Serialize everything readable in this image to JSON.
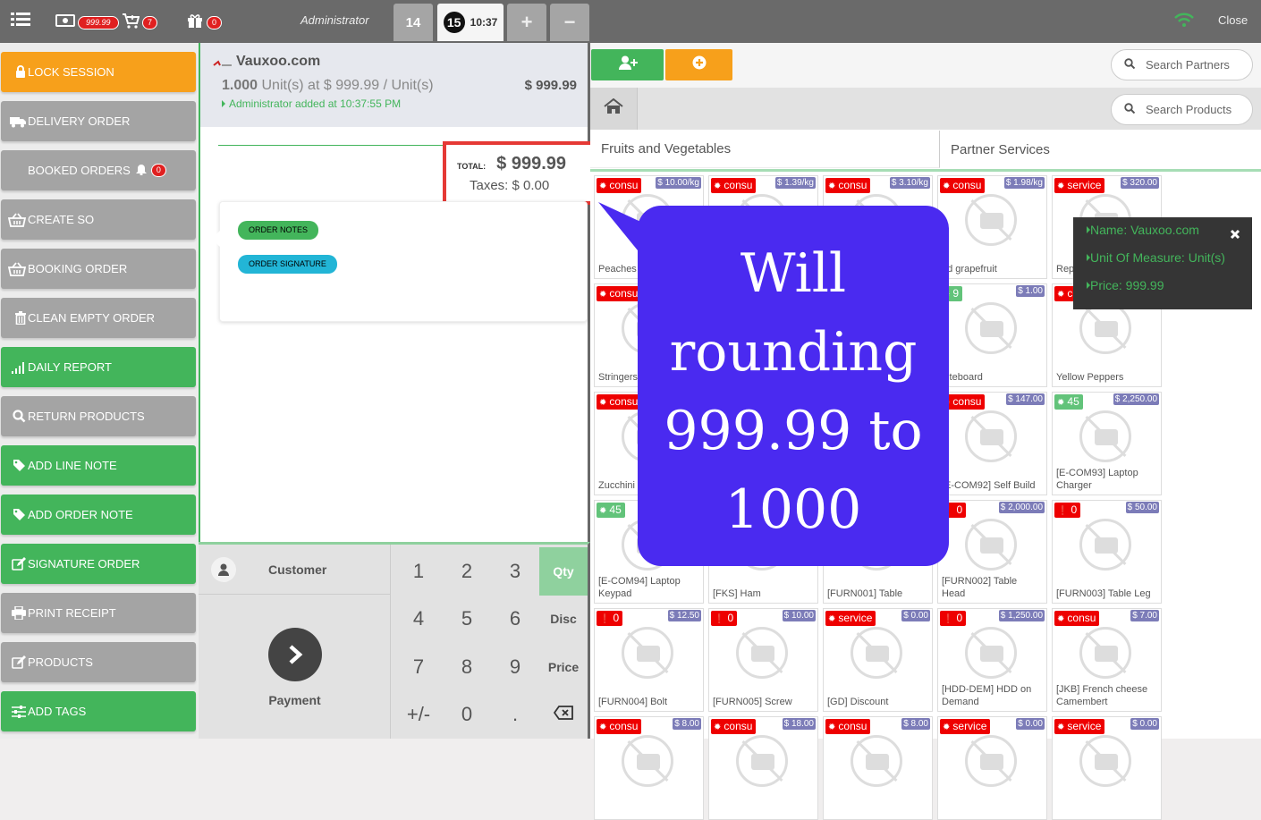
{
  "topbar": {
    "cash_badge": "999.99",
    "cart_badge": "7",
    "gift_badge": "0",
    "user": "Administrator",
    "order_tabs": [
      {
        "number": "14"
      },
      {
        "number": "15",
        "time": "10:37"
      }
    ],
    "add_label": "+",
    "remove_label": "−",
    "close_label": "Close"
  },
  "sidebar": [
    {
      "label": "LOCK SESSION",
      "icon": "lock-icon",
      "color": "orange"
    },
    {
      "label": "DELIVERY ORDER",
      "icon": "truck-icon",
      "color": "gray"
    },
    {
      "label": "BOOKED ORDERS",
      "icon": "bell-icon",
      "color": "gray",
      "badge": "0"
    },
    {
      "label": "CREATE SO",
      "icon": "basket-icon",
      "color": "gray"
    },
    {
      "label": "BOOKING ORDER",
      "icon": "basket-icon",
      "color": "gray"
    },
    {
      "label": "CLEAN EMPTY ORDER",
      "icon": "trash-icon",
      "color": "gray"
    },
    {
      "label": "DAILY REPORT",
      "icon": "signal-icon",
      "color": "green"
    },
    {
      "label": "RETURN PRODUCTS",
      "icon": "search-icon",
      "color": "gray"
    },
    {
      "label": "ADD LINE NOTE",
      "icon": "tag-icon",
      "color": "green"
    },
    {
      "label": "ADD ORDER NOTE",
      "icon": "tag-icon",
      "color": "green"
    },
    {
      "label": "SIGNATURE ORDER",
      "icon": "edit-icon",
      "color": "green"
    },
    {
      "label": "PRINT RECEIPT",
      "icon": "print-icon",
      "color": "gray"
    },
    {
      "label": "PRODUCTS",
      "icon": "edit-icon",
      "color": "gray"
    },
    {
      "label": "ADD TAGS",
      "icon": "sliders-icon",
      "color": "green"
    }
  ],
  "orderline": {
    "name": "Vauxoo.com",
    "qty": "1.000",
    "unit_text": "Unit(s) at $ 999.99 / Unit(s)",
    "price": "$ 999.99",
    "added": "Administrator added at 10:37:55 PM"
  },
  "summary": {
    "total_label": "TOTAL:",
    "total": "$ 999.99",
    "taxes": "Taxes: $ 0.00"
  },
  "notes": {
    "order_notes": "ORDER NOTES",
    "order_signature": "ORDER SIGNATURE"
  },
  "annotation": {
    "text": "Will rounding 999.99 to 1000",
    "color": "#4a2af0"
  },
  "pad": {
    "customer": "Customer",
    "payment": "Payment",
    "keys": [
      "1",
      "2",
      "3",
      "Qty",
      "4",
      "5",
      "6",
      "Disc",
      "7",
      "8",
      "9",
      "Price",
      "+/-",
      "0",
      "."
    ]
  },
  "search": {
    "partners_placeholder": "Search Partners",
    "products_placeholder": "Search Products"
  },
  "categories": [
    "Fruits and Vegetables",
    "Partner Services"
  ],
  "tooltip": {
    "name": "Name: Vauxoo.com",
    "uom": "Unit Of Measure: Unit(s)",
    "price": "Price: 999.99"
  },
  "products": [
    {
      "name": "Peaches",
      "tag": "consu",
      "price": "$ 10.00/kg"
    },
    {
      "name": "",
      "tag": "consu",
      "price": "$ 1.39/kg"
    },
    {
      "name": "",
      "tag": "consu",
      "price": "$ 3.10/kg"
    },
    {
      "name": "ed grapefruit",
      "tag": "consu",
      "price": "$ 1.98/kg"
    },
    {
      "name": "Repair",
      "tag": "service",
      "price": "$ 320.00"
    },
    {
      "name": "Stringers",
      "tag": "consu",
      "price": ""
    },
    {
      "name": "",
      "tag": "",
      "price": ""
    },
    {
      "name": "",
      "tag": "",
      "price": ""
    },
    {
      "name": "hiteboard",
      "tag": "9",
      "price": "$ 1.00"
    },
    {
      "name": "Yellow Peppers",
      "tag": "consu",
      "price": ""
    },
    {
      "name": "Zucchini",
      "tag": "consu",
      "price": ""
    },
    {
      "name": "",
      "tag": "",
      "price": ""
    },
    {
      "name": "",
      "tag": "",
      "price": ""
    },
    {
      "name": "[E-COM92] Self Build",
      "tag": "consu",
      "price": "$ 147.00"
    },
    {
      "name": "[E-COM93] Laptop Charger",
      "tag": "45",
      "price": "$ 2,250.00"
    },
    {
      "name": "[E-COM94] Laptop Keypad",
      "tag": "45",
      "price": ""
    },
    {
      "name": "[FKS] Ham",
      "tag": "",
      "price": ""
    },
    {
      "name": "[FURN001] Table",
      "tag": "",
      "price": ""
    },
    {
      "name": "[FURN002] Table Head",
      "tag": "0",
      "price": "$ 2,000.00"
    },
    {
      "name": "[FURN003] Table Leg",
      "tag": "0",
      "price": "$ 50.00"
    },
    {
      "name": "[FURN004] Bolt",
      "tag": "0",
      "price": "$ 12.50"
    },
    {
      "name": "[FURN005] Screw",
      "tag": "0",
      "price": "$ 10.00"
    },
    {
      "name": "[GD] Discount",
      "tag": "service",
      "price": "$ 0.00"
    },
    {
      "name": "[HDD-DEM] HDD on Demand",
      "tag": "0",
      "price": "$ 1,250.00"
    },
    {
      "name": "[JKB] French cheese Camembert",
      "tag": "consu",
      "price": "$ 7.00"
    },
    {
      "name": "",
      "tag": "consu",
      "price": "$ 8.00"
    },
    {
      "name": "",
      "tag": "consu",
      "price": "$ 18.00"
    },
    {
      "name": "",
      "tag": "consu",
      "price": "$ 8.00"
    },
    {
      "name": "",
      "tag": "service",
      "price": "$ 0.00"
    },
    {
      "name": "",
      "tag": "service",
      "price": "$ 0.00"
    }
  ]
}
